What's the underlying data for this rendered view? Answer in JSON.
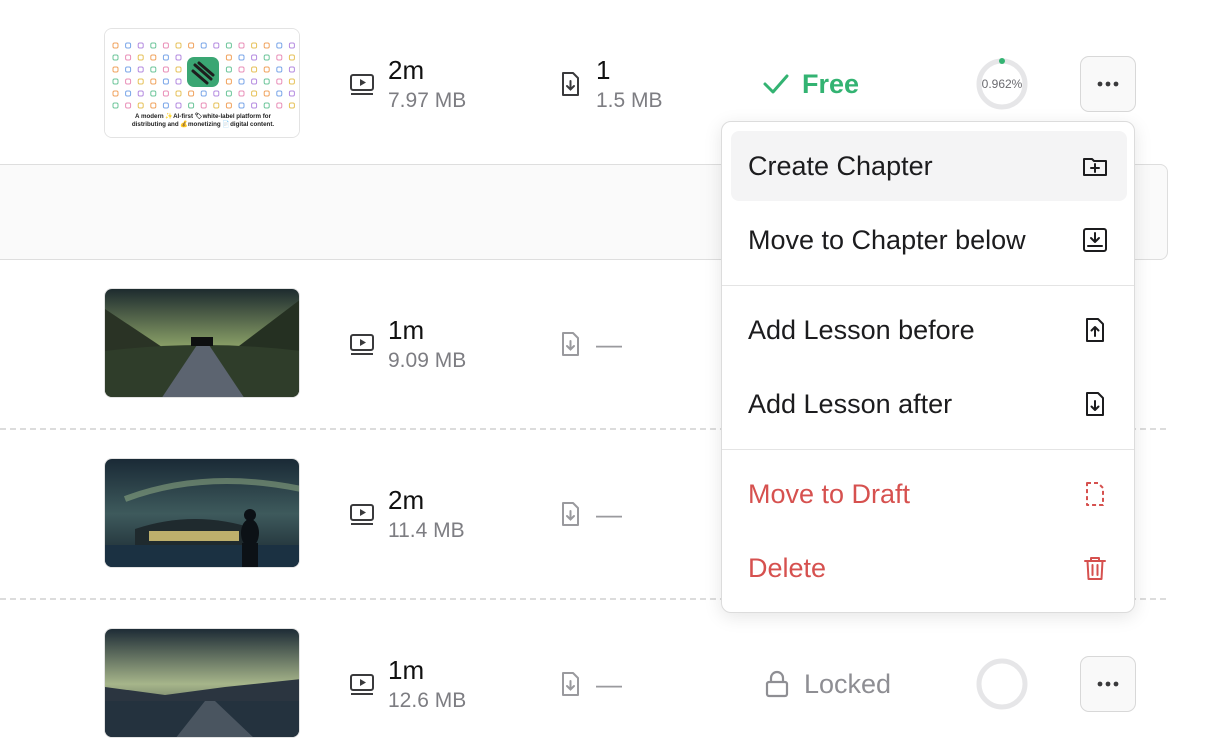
{
  "lessons": [
    {
      "thumb": "platform-banner",
      "duration": "2m",
      "video_size": "7.97 MB",
      "attachments_count": "1",
      "attachments_size": "1.5 MB",
      "status": "Free",
      "progress_label": "0.962%",
      "progress": 0.00962
    },
    {
      "thumb": "night-road-sky",
      "duration": "1m",
      "video_size": "9.09 MB",
      "attachments_dash": "—"
    },
    {
      "thumb": "night-house-person",
      "duration": "2m",
      "video_size": "11.4 MB",
      "attachments_dash": "—"
    },
    {
      "thumb": "night-lake-road",
      "duration": "1m",
      "video_size": "12.6 MB",
      "attachments_dash": "—",
      "status": "Locked",
      "progress": 0
    }
  ],
  "banner": {
    "line1": "A modern ✨AI-first 🏷white-label platform for",
    "line2": "distributing and 💰monetizing 📄digital content."
  },
  "menu": {
    "items": [
      {
        "label": "Create Chapter",
        "icon": "folder-plus-icon"
      },
      {
        "label": "Move to Chapter below",
        "icon": "tray-down-icon"
      },
      {
        "label": "Add Lesson before",
        "icon": "file-arrow-up-icon"
      },
      {
        "label": "Add Lesson after",
        "icon": "file-arrow-down-icon"
      },
      {
        "label": "Move to Draft",
        "icon": "dashed-file-icon"
      },
      {
        "label": "Delete",
        "icon": "trash-icon"
      }
    ]
  },
  "colors": {
    "free": "#33b372",
    "danger": "#d6514f",
    "muted": "#7d7d82"
  }
}
